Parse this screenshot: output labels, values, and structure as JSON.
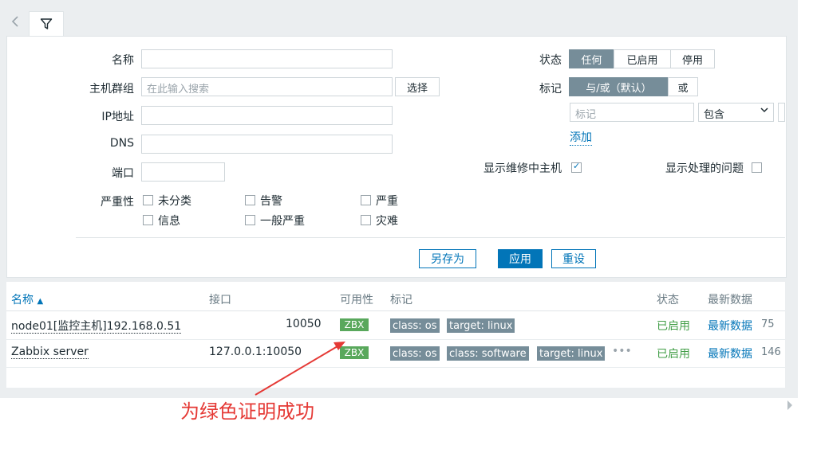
{
  "filter": {
    "name_label": "名称",
    "host_group_label": "主机群组",
    "host_group_placeholder": "在此输入搜索",
    "select_button": "选择",
    "ip_label": "IP地址",
    "dns_label": "DNS",
    "port_label": "端口",
    "severity_label": "严重性",
    "severities": [
      "未分类",
      "告警",
      "严重",
      "信息",
      "一般严重",
      "灾难"
    ],
    "status_label": "状态",
    "status_options": [
      "任何",
      "已启用",
      "停用"
    ],
    "tag_label": "标记",
    "tag_mode_options": [
      "与/或（默认）",
      "或"
    ],
    "tag_placeholder": "标记",
    "tag_operator": "包含",
    "add_link": "添加",
    "show_maintenance_label": "显示维修中主机",
    "show_suppressed_label": "显示处理的问题",
    "save_as_button": "另存为",
    "apply_button": "应用",
    "reset_button": "重设"
  },
  "table": {
    "headers": [
      "名称",
      "接口",
      "可用性",
      "标记",
      "状态",
      "最新数据"
    ],
    "sort_indicator": "▲",
    "rows": [
      {
        "name": "node01[监控主机]192.168.0.51",
        "interface": "10050",
        "availability": "ZBX",
        "tags": [
          "class: os",
          "target: linux"
        ],
        "status": "已启用",
        "latest": "最新数据",
        "count": "75"
      },
      {
        "name": "Zabbix server",
        "interface": "127.0.0.1:10050",
        "availability": "ZBX",
        "tags": [
          "class: os",
          "class: software",
          "target: linux"
        ],
        "more": "•••",
        "status": "已启用",
        "latest": "最新数据",
        "count": "146"
      }
    ]
  },
  "annotation": "为绿色证明成功",
  "colors": {
    "accent": "#0275b8",
    "available_green": "#59a85c",
    "tag_gray": "#768d99",
    "annotation_red": "#e53935"
  },
  "icons": {
    "tab": "filter-icon",
    "back": "chevron-left-icon"
  }
}
